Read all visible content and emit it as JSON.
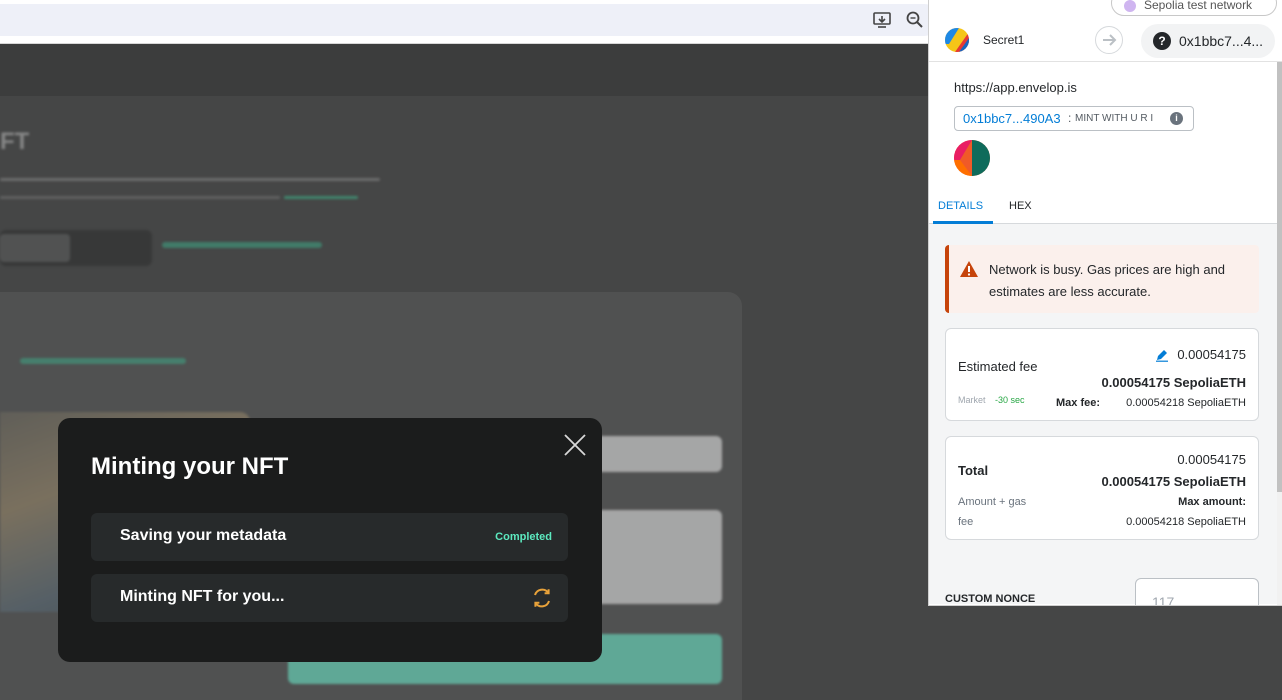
{
  "browser": {
    "icons": [
      "install-icon",
      "zoom-icon"
    ]
  },
  "background_page": {
    "title": "FT"
  },
  "modal": {
    "title": "Minting your NFT",
    "steps": [
      {
        "label": "Saving your metadata",
        "status": "Completed"
      },
      {
        "label": "Minting NFT for you..."
      }
    ]
  },
  "metamask": {
    "network": "Sepolia test network",
    "account_name": "Secret1",
    "to_badge": "?",
    "to_address": "0x1bbc7...4...",
    "origin": "https://app.envelop.is",
    "contract_link": "0x1bbc7...490A3",
    "separator": ":",
    "method": "MINT WITH U R I",
    "info_glyph": "i",
    "tabs": [
      "DETAILS",
      "HEX"
    ],
    "warning": "Network is busy. Gas prices are high and estimates are less accurate.",
    "fee": {
      "label": "Estimated fee",
      "fiat_value": "0.00054175",
      "eth_value": "0.00054175 SepoliaETH",
      "market_label": "Market",
      "market_time": "-30 sec",
      "max_fee_label": "Max fee:",
      "max_fee_value": "0.00054218 SepoliaETH"
    },
    "total": {
      "label": "Total",
      "fiat_value": "0.00054175",
      "eth_value": "0.00054175 SepoliaETH",
      "sub_label_1": "Amount + gas",
      "sub_label_2": "fee",
      "max_amount_label": "Max amount:",
      "max_amount_value": "0.00054218 SepoliaETH"
    },
    "custom_nonce_label": "CUSTOM NONCE",
    "custom_nonce_placeholder": "117"
  },
  "colors": {
    "accent_teal": "#5ce9bf",
    "metamask_blue": "#037dd6",
    "warning_orange": "#c6440b",
    "spinner_orange": "#e8a23a"
  }
}
